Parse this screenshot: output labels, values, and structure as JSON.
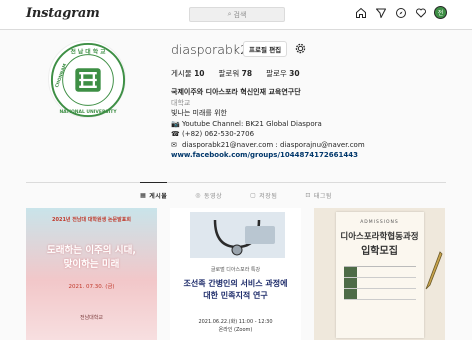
{
  "nav": {
    "logo": "Instagram",
    "search_placeholder": "검색",
    "icons": [
      "home-icon",
      "direct-icon",
      "explore-icon",
      "heart-icon",
      "avatar"
    ],
    "avatar_initial": "전"
  },
  "profile": {
    "username": "diasporabk21",
    "edit_button": "프로필 편집",
    "stats": [
      {
        "label": "게시물",
        "value": "10"
      },
      {
        "label": "팔로워",
        "value": "78"
      },
      {
        "label": "팔로우",
        "value": "30"
      }
    ],
    "full_name": "국제이주와 디아스포라 혁신인재 교육연구단",
    "category": "대학교",
    "bio_line": "빛나는 미래를 위한",
    "youtube": "Youtube Channel: BK21 Global Diaspora",
    "phone": "(+82) 062-530-2706",
    "email": "diasporabk21@naver.com : diasporajnu@naver.com",
    "website": "www.facebook.com/groups/1044874172661443"
  },
  "tabs": [
    {
      "label": "게시물",
      "icon": "grid-icon"
    },
    {
      "label": "동영상",
      "icon": "video-icon"
    },
    {
      "label": "저장됨",
      "icon": "bookmark-icon"
    },
    {
      "label": "태그됨",
      "icon": "tag-icon"
    }
  ],
  "posts": [
    {
      "header": "2021년 전남대 대학원생 논문발표회",
      "title_line1": "도래하는 이주의 시대,",
      "title_line2": "맞이하는 미래",
      "date": "2021. 07.30. (금)",
      "footer": "전남대학교"
    },
    {
      "header": "글로벌 디아스포라 특강",
      "title_line1": "조선족 간병인의 서비스 과정에",
      "title_line2": "대한 민족지적 연구",
      "date": "2021.06.22.(화) 11:00 - 12:30",
      "footer": "온라인 (Zoom)"
    },
    {
      "header": "ADMISSIONS",
      "title_line1": "디아스포라학협동과정",
      "title_line2": "입학모집",
      "date": "",
      "footer": ""
    }
  ],
  "colors": {
    "accent": "#3e8f45",
    "link": "#00376b"
  }
}
